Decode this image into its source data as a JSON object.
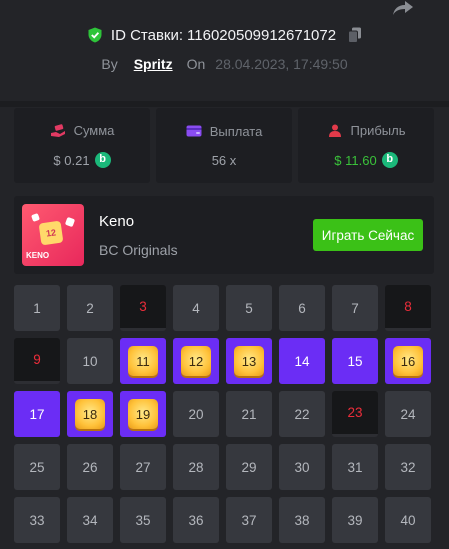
{
  "header": {
    "bet_id_label": "ID Ставки:",
    "bet_id": "116020509912671072",
    "by_label": "By",
    "username": "Spritz",
    "on_label": "On",
    "date": "28.04.2023, 17:49:50"
  },
  "stats": [
    {
      "label": "Сумма",
      "value": "$ 0.21",
      "icon": "money-hand-icon",
      "coin": true,
      "color": "#9ea2a9"
    },
    {
      "label": "Выплата",
      "value": "56 x",
      "icon": "wallet-icon",
      "coin": false,
      "color": "#9ea2a9"
    },
    {
      "label": "Прибыль",
      "value": "$ 11.60",
      "icon": "profit-user-icon",
      "coin": true,
      "color": "#3ac13a"
    }
  ],
  "game": {
    "title": "Keno",
    "subtitle": "BC Originals",
    "play_label": "Играть Сейчас",
    "thumb_number": "12",
    "thumb_tag": "KENO"
  },
  "grid": {
    "numbers": [
      1,
      2,
      3,
      4,
      5,
      6,
      7,
      8,
      9,
      10,
      11,
      12,
      13,
      14,
      15,
      16,
      17,
      18,
      19,
      20,
      21,
      22,
      23,
      24,
      25,
      26,
      27,
      28,
      29,
      30,
      31,
      32,
      33,
      34,
      35,
      36,
      37,
      38,
      39,
      40
    ],
    "drawn_miss": [
      3,
      8,
      9,
      23
    ],
    "selected_no_hit": [
      14,
      15,
      17
    ],
    "hits": [
      11,
      12,
      13,
      16,
      18,
      19
    ]
  },
  "colors": {
    "background": "#232428",
    "panel": "#1d1e22",
    "cell": "#36383e",
    "selected": "#6b2df5",
    "miss_text": "#ec2d3a",
    "play_button": "#3bc117",
    "profit": "#3ac13a"
  }
}
